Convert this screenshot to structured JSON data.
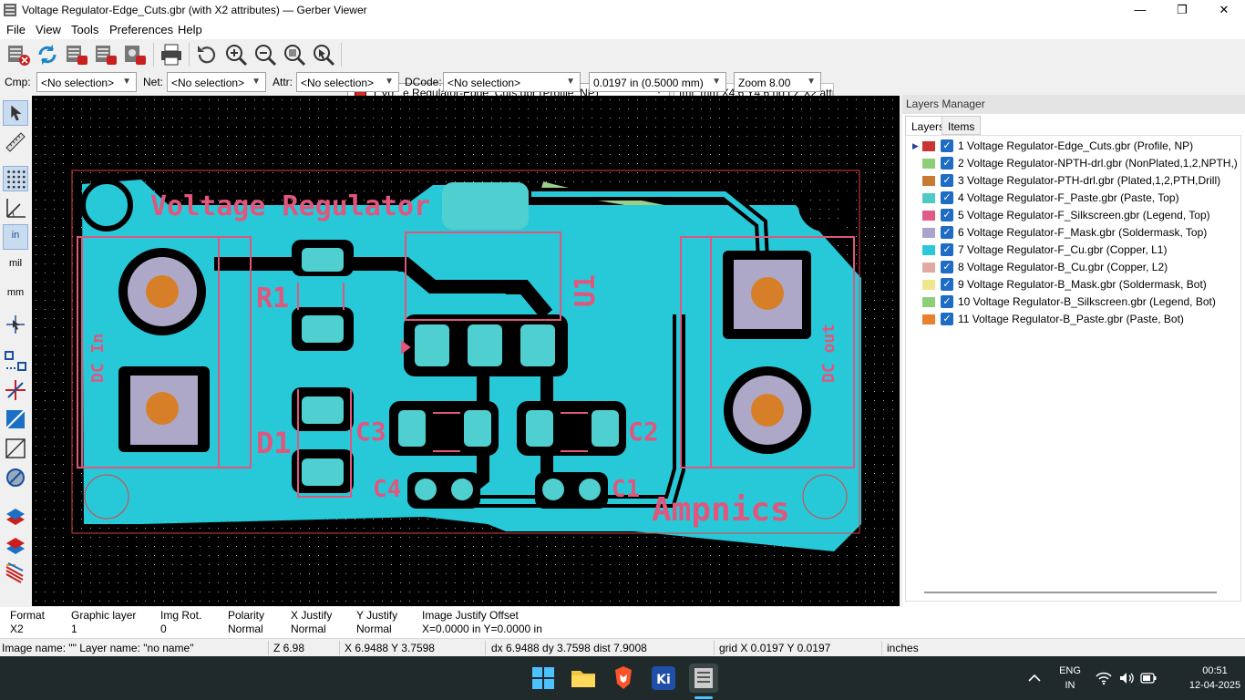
{
  "window": {
    "title": "Voltage Regulator-Edge_Cuts.gbr (with X2 attributes) — Gerber Viewer",
    "app_icon": "gerbview-icon",
    "controls": {
      "minimize": "—",
      "maximize": "❐",
      "close": "✕"
    }
  },
  "menu": [
    "File",
    "View",
    "Tools",
    "Preferences",
    "Help"
  ],
  "toolbar": {
    "layer_selector": "1 Vo...e Regulator-Edge_Cuts.gbr (Profile, NP)",
    "format": "fmt: mm X4.6 Y4.6 no LZ X2 attr"
  },
  "filters": {
    "cmp_label": "Cmp:",
    "cmp_value": "<No selection>",
    "net_label": "Net:",
    "net_value": "<No selection>",
    "attr_label": "Attr:",
    "attr_value": "<No selection>",
    "dcode_label": "DCode:",
    "dcode_value": "<No selection>",
    "grid_value": "0.0197 in (0.5000 mm)",
    "zoom_value": "Zoom 8.00"
  },
  "left_toolbar": {
    "in": "in",
    "mil": "mil",
    "mm": "mm"
  },
  "board": {
    "silk": {
      "title": "Voltage Regulator",
      "brand": "Ampnics",
      "r1": "R1",
      "u1": "U1",
      "d1": "D1",
      "c1": "C1",
      "c2": "C2",
      "c3": "C3",
      "c4": "C4",
      "dc_in": "DC In",
      "dc_out": "DC out"
    },
    "colors": {
      "background": "#000000",
      "copper": "#27c9d9",
      "paste": "#4fcfcf",
      "edge_cuts": "#e0403c",
      "silkscreen": "#e0567c",
      "drill": "#d77f28",
      "mask": "#aea8c8",
      "back_silk": "#9ccf86"
    }
  },
  "layers_manager": {
    "title": "Layers Manager",
    "tabs": [
      "Layers",
      "Items"
    ],
    "layers": [
      {
        "name": "1 Voltage Regulator-Edge_Cuts.gbr (Profile, NP)",
        "color": "#cc3333",
        "selected": true
      },
      {
        "name": "2 Voltage Regulator-NPTH-drl.gbr (NonPlated,1,2,NPTH,)",
        "color": "#8fce78"
      },
      {
        "name": "3 Voltage Regulator-PTH-drl.gbr (Plated,1,2,PTH,Drill)",
        "color": "#c87a32"
      },
      {
        "name": "4 Voltage Regulator-F_Paste.gbr (Paste, Top)",
        "color": "#4ec9c4"
      },
      {
        "name": "5 Voltage Regulator-F_Silkscreen.gbr (Legend, Top)",
        "color": "#e25a86"
      },
      {
        "name": "6 Voltage Regulator-F_Mask.gbr (Soldermask, Top)",
        "color": "#aaa4cc"
      },
      {
        "name": "7 Voltage Regulator-F_Cu.gbr (Copper, L1)",
        "color": "#2bc8d8"
      },
      {
        "name": "8 Voltage Regulator-B_Cu.gbr (Copper, L2)",
        "color": "#e0aaa0"
      },
      {
        "name": "9 Voltage Regulator-B_Mask.gbr (Soldermask, Bot)",
        "color": "#f0e68c"
      },
      {
        "name": "10 Voltage Regulator-B_Silkscreen.gbr (Legend, Bot)",
        "color": "#8fce78"
      },
      {
        "name": "11 Voltage Regulator-B_Paste.gbr (Paste, Bot)",
        "color": "#e8802c"
      }
    ]
  },
  "message_panel": [
    {
      "label": "Format",
      "value": "X2"
    },
    {
      "label": "Graphic layer",
      "value": "1"
    },
    {
      "label": "Img Rot.",
      "value": "0"
    },
    {
      "label": "Polarity",
      "value": "Normal"
    },
    {
      "label": "X Justify",
      "value": "Normal"
    },
    {
      "label": "Y Justify",
      "value": "Normal"
    },
    {
      "label": "Image Justify Offset",
      "value": "X=0.0000 in Y=0.0000 in"
    }
  ],
  "status": {
    "image": "Image name: \"\"  Layer name: \"no name\"",
    "z": "Z 6.98",
    "xy": "X 6.9488  Y 3.7598",
    "dist": "dx 6.9488  dy 3.7598  dist 7.9008",
    "grid": "grid X 0.0197  Y 0.0197",
    "units": "inches"
  },
  "taskbar": {
    "lang": "ENG",
    "region": "IN",
    "time": "00:51",
    "date": "12-04-2025"
  }
}
